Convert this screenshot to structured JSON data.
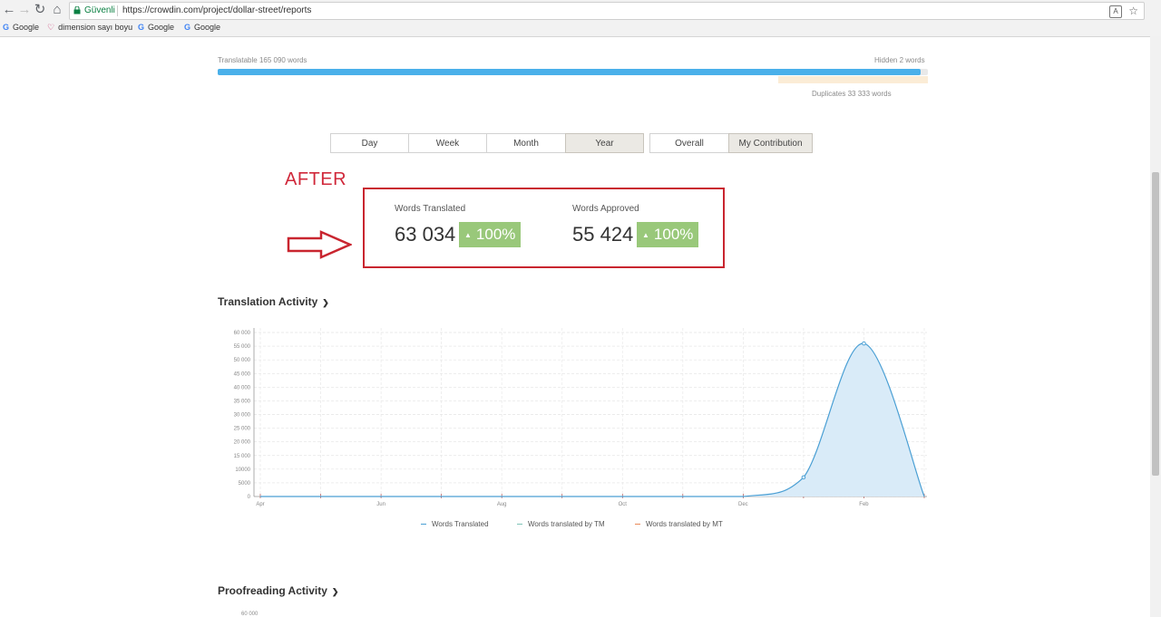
{
  "browser": {
    "secure_label": "Güvenli",
    "url": "https://crowdin.com/project/dollar-street/reports",
    "bookmarks": [
      {
        "icon": "google-icon",
        "label": "Google"
      },
      {
        "icon": "dimension-icon",
        "label": "dimension sayı boyu"
      },
      {
        "icon": "google-icon",
        "label": "Google"
      },
      {
        "icon": "google-icon",
        "label": "Google"
      }
    ]
  },
  "progress": {
    "translatable": "Translatable 165 090 words",
    "hidden": "Hidden 2 words",
    "duplicates": "Duplicates 33 333 words",
    "fill_fraction": 0.99,
    "fill_color": "#4ab0ea",
    "duplicates_color": "#fbecd6"
  },
  "filters": {
    "period": [
      "Day",
      "Week",
      "Month",
      "Year"
    ],
    "period_active": "Year",
    "scope": [
      "Overall",
      "My Contribution"
    ],
    "scope_active": "My Contribution"
  },
  "annotation": {
    "label": "AFTER",
    "color": "#d0283a"
  },
  "stats": {
    "translated": {
      "title": "Words Translated",
      "value": "63 034",
      "badge": "100%"
    },
    "approved": {
      "title": "Words Approved",
      "value": "55 424",
      "badge": "100%"
    },
    "badge_color": "#99c87a"
  },
  "translation_section": {
    "title": "Translation Activity"
  },
  "proofreading_section": {
    "title": "Proofreading Activity",
    "partial_tick": "60 000"
  },
  "chart_data": {
    "type": "area",
    "x_ticks": [
      "Apr",
      "Jun",
      "Aug",
      "Oct",
      "Dec",
      "Feb"
    ],
    "y_ticks": [
      "0",
      "5000",
      "10000",
      "15 000",
      "20 000",
      "25 000",
      "30 000",
      "35 000",
      "40 000",
      "45 000",
      "50 000",
      "55 000",
      "60 000"
    ],
    "ylim": [
      0,
      60000
    ],
    "grid": true,
    "legend_position": "bottom",
    "series": [
      {
        "name": "Words Translated",
        "color": "#4a9fd4",
        "fill": "#d9ebf8",
        "points": [
          {
            "x": "Apr",
            "y": 0
          },
          {
            "x": "Jun",
            "y": 0
          },
          {
            "x": "Aug",
            "y": 0
          },
          {
            "x": "Oct",
            "y": 0
          },
          {
            "x": "Dec",
            "y": 0
          },
          {
            "x": "Jan",
            "y": 7000
          },
          {
            "x": "Feb",
            "y": 56000
          },
          {
            "x": "Mar",
            "y": 0
          }
        ]
      },
      {
        "name": "Words translated by TM",
        "color": "#7fc3b8"
      },
      {
        "name": "Words translated by MT",
        "color": "#e98a5a"
      }
    ]
  }
}
